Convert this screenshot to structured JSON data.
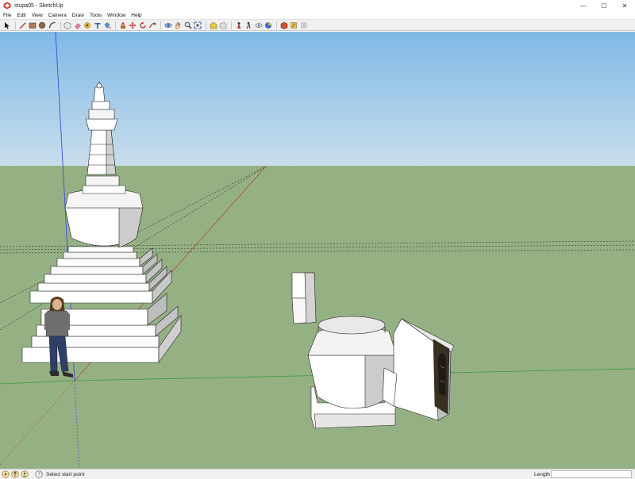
{
  "window": {
    "title": "stupa05 - SketchUp",
    "minimize_glyph": "—",
    "maximize_glyph": "☐",
    "close_glyph": "✕"
  },
  "menu": {
    "items": [
      "File",
      "Edit",
      "View",
      "Camera",
      "Draw",
      "Tools",
      "Window",
      "Help"
    ]
  },
  "toolbar": {
    "tools": [
      "select-icon",
      "pencil-line-icon",
      "rectangle-icon",
      "circle-icon",
      "arc-icon",
      "eraser-icon",
      "paint-bucket-icon",
      "tape-measure-icon",
      "text-icon",
      "push-pull-icon",
      "move-icon",
      "rotate-icon",
      "follow-me-icon",
      "orbit-icon",
      "pan-icon",
      "zoom-icon",
      "zoom-extents-icon",
      "section-plane-icon",
      "walk-icon",
      "position-camera-icon",
      "look-around-icon",
      "components-icon",
      "3d-warehouse-icon",
      "extension-warehouse-icon",
      "layout-icon",
      "extension-icon"
    ]
  },
  "status": {
    "message": "Select start point",
    "measurements_label": "Length",
    "measurements_value": "",
    "icons": [
      "geo-location-icon",
      "credits-icon",
      "user-icon",
      "help-icon"
    ]
  },
  "colors": {
    "sky_top": "#7fb9e6",
    "sky_bottom": "#c7ddec",
    "ground": "#95b184",
    "axis_blue": "#3c4fd8",
    "axis_red": "#b84a3a",
    "axis_green": "#3a9a3a"
  }
}
